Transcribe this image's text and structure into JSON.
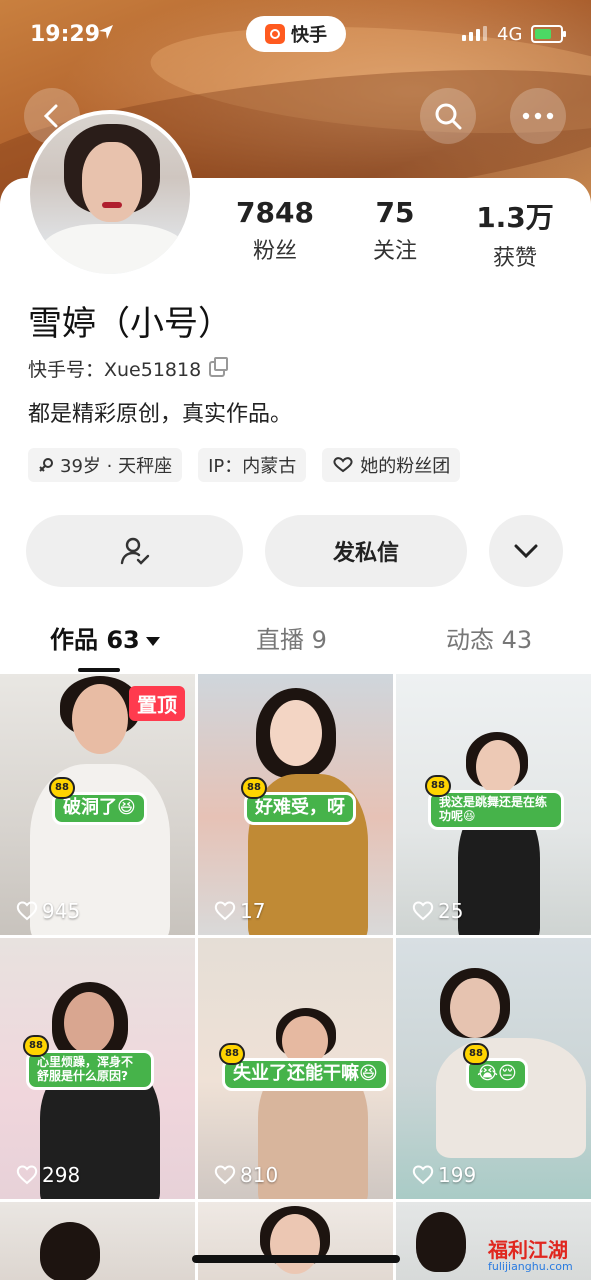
{
  "status_bar": {
    "time": "19:29",
    "network": "4G",
    "app_badge": "快手"
  },
  "profile": {
    "stats": [
      {
        "value": "7848",
        "label": "粉丝"
      },
      {
        "value": "75",
        "label": "关注"
      },
      {
        "value": "1.3万",
        "label": "获赞"
      }
    ],
    "name": "雪婷（小号）",
    "kuaishou_id": "快手号：Xue51818",
    "bio": "都是精彩原创，真实作品。",
    "tags": [
      {
        "icon": "gender-female-icon",
        "text": "39岁 · 天秤座"
      },
      {
        "icon": "",
        "text": "IP：内蒙古"
      },
      {
        "icon": "heart-icon",
        "text": "她的粉丝团"
      }
    ]
  },
  "actions": {
    "message_label": "发私信"
  },
  "tabs": [
    {
      "label": "作品 63",
      "active": true
    },
    {
      "label": "直播 9",
      "active": false
    },
    {
      "label": "动态 43",
      "active": false
    }
  ],
  "grid": [
    {
      "likes": "945",
      "sticker": "破洞了😆",
      "pinned_label": "置顶"
    },
    {
      "likes": "17",
      "sticker": "好难受，呀"
    },
    {
      "likes": "25",
      "sticker": "我这是跳舞还是在练功呢😆"
    },
    {
      "likes": "298",
      "sticker": "心里烦躁，浑身不舒服是什么原因?"
    },
    {
      "likes": "810",
      "sticker": "失业了还能干嘛😆"
    },
    {
      "likes": "199",
      "sticker": "😭😔"
    }
  ],
  "watermark": {
    "title": "福利江湖",
    "url": "fulijianghu.com"
  },
  "colors": {
    "accent": "#ff5a1f",
    "sticker_green": "#46b34a",
    "pin_red": "#ff3b4e"
  }
}
